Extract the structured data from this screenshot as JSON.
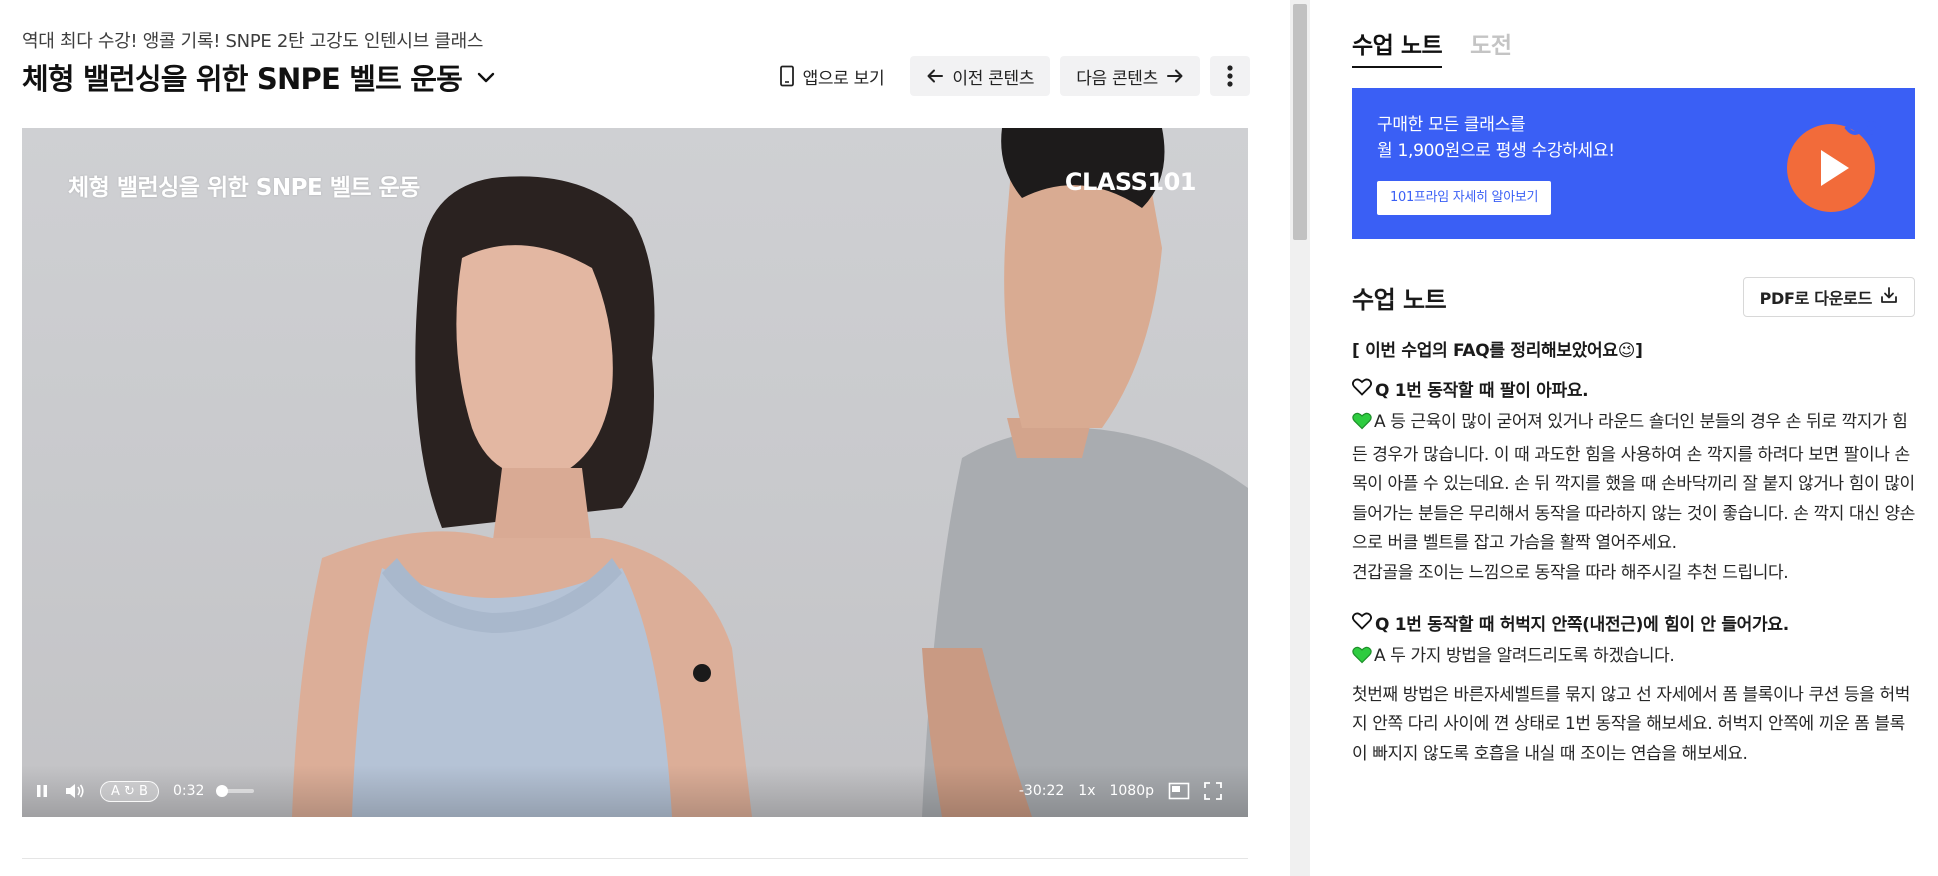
{
  "header": {
    "course_name": "역대 최다 수강! 앵콜 기록! SNPE 2탄 고강도 인텐시브 클래스",
    "lesson_title": "체형 밸런싱을 위한 SNPE 벨트 운동",
    "app_view_label": "앱으로 보기",
    "prev_label": "이전 콘텐츠",
    "next_label": "다음 콘텐츠"
  },
  "video": {
    "caption": "체형 밸런싱을 위한 SNPE 벨트 운동",
    "logo": "CLASS101",
    "controls": {
      "ab_repeat": "A ↻ B",
      "current_time": "0:32",
      "remaining_time": "-30:22",
      "speed": "1x",
      "quality": "1080p",
      "progress": 0.017
    }
  },
  "panel": {
    "tabs": [
      {
        "label": "수업 노트",
        "active": true
      },
      {
        "label": "도전",
        "active": false
      }
    ],
    "banner": {
      "line1": "구매한 모든 클래스를",
      "line2": "월 1,900원으로 평생 수강하세요!",
      "button": "101프라임 자세히 알아보기",
      "color": "#3a5ff5"
    },
    "notes": {
      "title": "수업 노트",
      "pdf_button": "PDF로 다운로드",
      "intro": "[ 이번 수업의 FAQ를 정리해보았어요😉]",
      "faq": [
        {
          "question": "Q 1번 동작할 때 팔이 아파요.",
          "answer": "A 등 근육이 많이 굳어져 있거나 라운드 숄더인 분들의 경우 손 뒤로 깍지가 힘든 경우가 많습니다. 이 때 과도한 힘을 사용하여 손 깍지를 하려다 보면 팔이나 손목이 아플 수 있는데요. 손 뒤 깍지를 했을 때 손바닥끼리 잘 붙지 않거나 힘이 많이 들어가는 분들은 무리해서 동작을 따라하지 않는 것이 좋습니다. 손 깍지 대신 양손으로 버클 벨트를 잡고 가슴을 활짝 열어주세요.",
          "answer_extra": "견갑골을 조이는 느낌으로 동작을 따라 해주시길 추천 드립니다."
        },
        {
          "question": "Q 1번 동작할 때 허벅지 안쪽(내전근)에 힘이 안 들어가요.",
          "answer": "A 두 가지 방법을 알려드리도록 하겠습니다.",
          "answer_extra": "첫번째 방법은 바른자세벨트를 묶지 않고 선 자세에서 폼 블록이나 쿠션 등을 허벅지 안쪽 다리 사이에 껸 상태로 1번 동작을 해보세요. 허벅지 안쪽에 끼운 폼 블록이 빠지지 않도록 호흡을 내실 때 조이는 연습을 해보세요."
        }
      ]
    }
  },
  "colors": {
    "accent": "#3a5ff5",
    "heart_green": "#2ecc40",
    "banner_orange": "#f26b3a"
  }
}
